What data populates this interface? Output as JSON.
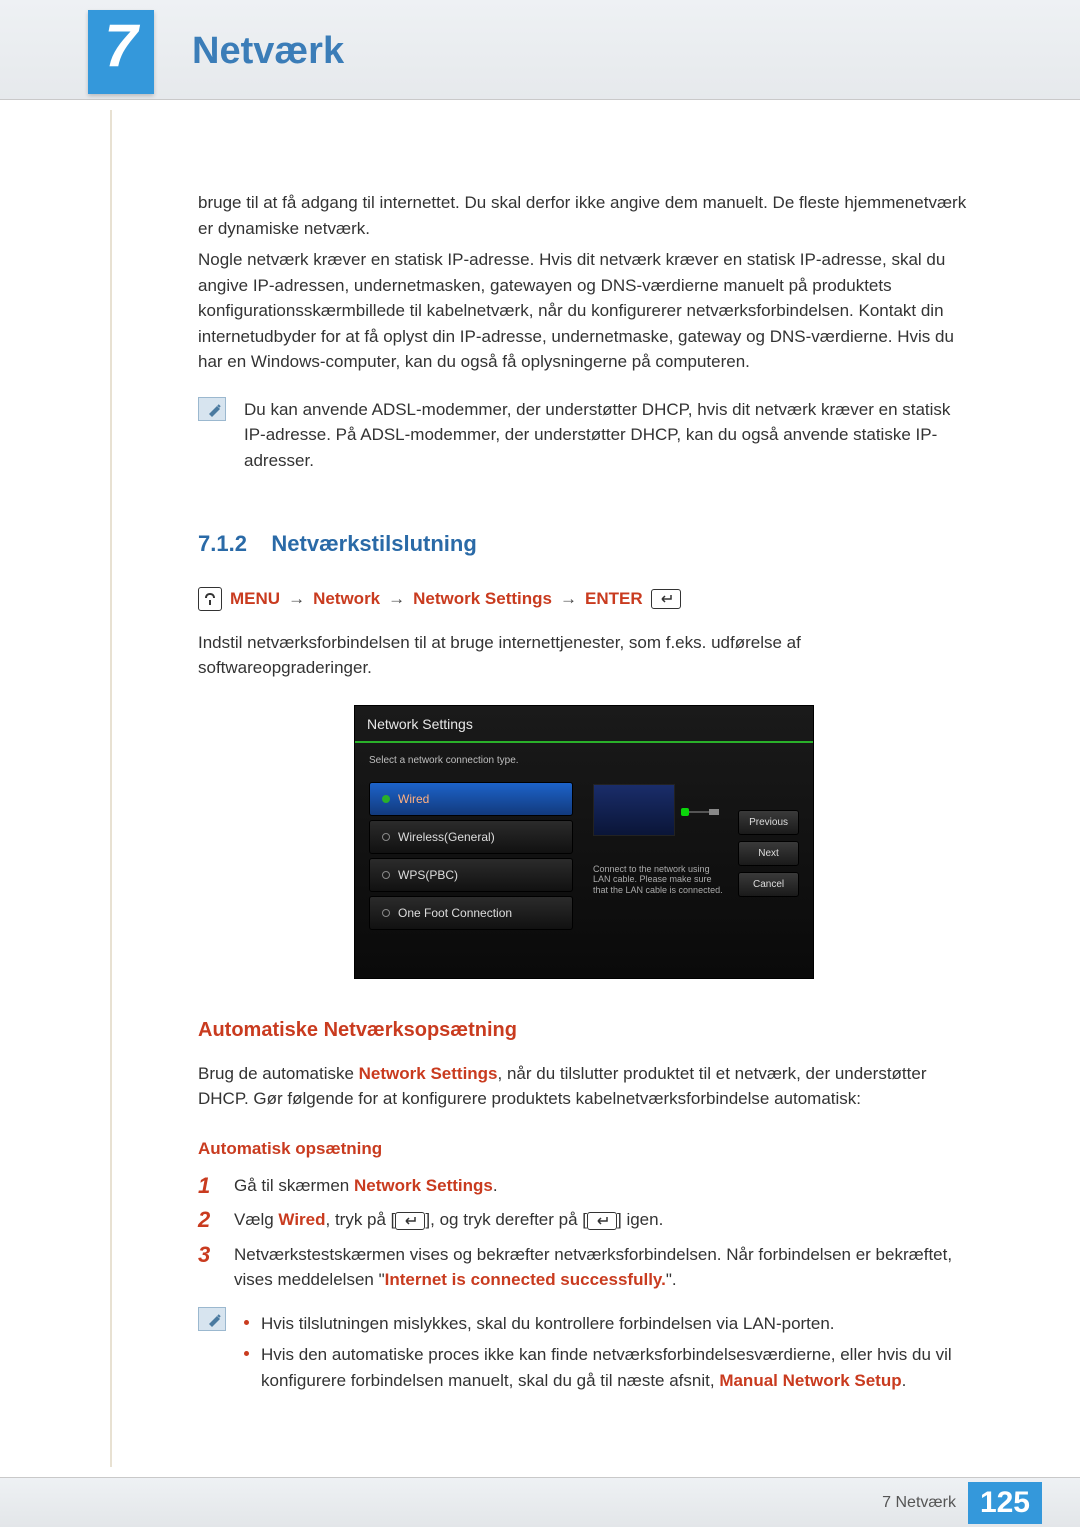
{
  "chapter": {
    "number": "7",
    "title": "Netværk"
  },
  "intro": {
    "p1": "bruge til at få adgang til internettet. Du skal derfor ikke angive dem manuelt. De fleste hjemmenetværk er dynamiske netværk.",
    "p2": "Nogle netværk kræver en statisk IP-adresse. Hvis dit netværk kræver en statisk IP-adresse, skal du angive IP-adressen, undernetmasken, gatewayen og DNS-værdierne manuelt på produktets konfigurationsskærmbillede til kabelnetværk, når du konfigurerer netværksforbindelsen. Kontakt din internetudbyder for at få oplyst din IP-adresse, undernetmaske, gateway og DNS-værdierne. Hvis du har en Windows-computer, kan du også få oplysningerne på computeren.",
    "note": "Du kan anvende ADSL-modemmer, der understøtter DHCP, hvis dit netværk kræver en statisk IP-adresse. På ADSL-modemmer, der understøtter DHCP, kan du også anvende statiske IP-adresser."
  },
  "section": {
    "num": "7.1.2",
    "title": "Netværkstilslutning"
  },
  "menu_path": {
    "m1": "MENU",
    "m2": "Network",
    "m3": "Network Settings",
    "m4": "ENTER"
  },
  "desc": "Indstil netværksforbindelsen til at bruge internettjenester, som f.eks. udførelse af softwareopgraderinger.",
  "osd": {
    "title": "Network Settings",
    "hint": "Select a network connection type.",
    "items": [
      "Wired",
      "Wireless(General)",
      "WPS(PBC)",
      "One Foot Connection"
    ],
    "right_hint": "Connect to the network using LAN cable. Please make sure that the LAN cable is connected.",
    "btns": [
      "Previous",
      "Next",
      "Cancel"
    ]
  },
  "auto": {
    "h3": "Automatiske Netværksopsætning",
    "p_pre": "Brug de automatiske ",
    "p_red": "Network Settings",
    "p_post": ", når du tilslutter produktet til et netværk, der understøtter DHCP. Gør følgende for at konfigurere produktets kabelnetværksforbindelse automatisk:",
    "h4": "Automatisk opsætning",
    "steps": {
      "s1_pre": "Gå til skærmen ",
      "s1_red": "Network Settings",
      "s1_post": ".",
      "s2_pre": "Vælg ",
      "s2_red": "Wired",
      "s2_mid1": ", tryk på [",
      "s2_mid2": "], og tryk derefter på [",
      "s2_post": "] igen.",
      "s3_pre": "Netværkstestskærmen vises og bekræfter netværksforbindelsen. Når forbindelsen er bekræftet, vises meddelelsen \"",
      "s3_red": "Internet is connected successfully.",
      "s3_post": "\"."
    },
    "bullets": {
      "b1": "Hvis tilslutningen mislykkes, skal du kontrollere forbindelsen via LAN-porten.",
      "b2_pre": "Hvis den automatiske proces ikke kan finde netværksforbindelsesværdierne, eller hvis du vil konfigurere forbindelsen manuelt, skal du gå til næste afsnit, ",
      "b2_red": "Manual Network Setup",
      "b2_post": "."
    }
  },
  "footer": {
    "label": "7 Netværk",
    "page": "125"
  }
}
